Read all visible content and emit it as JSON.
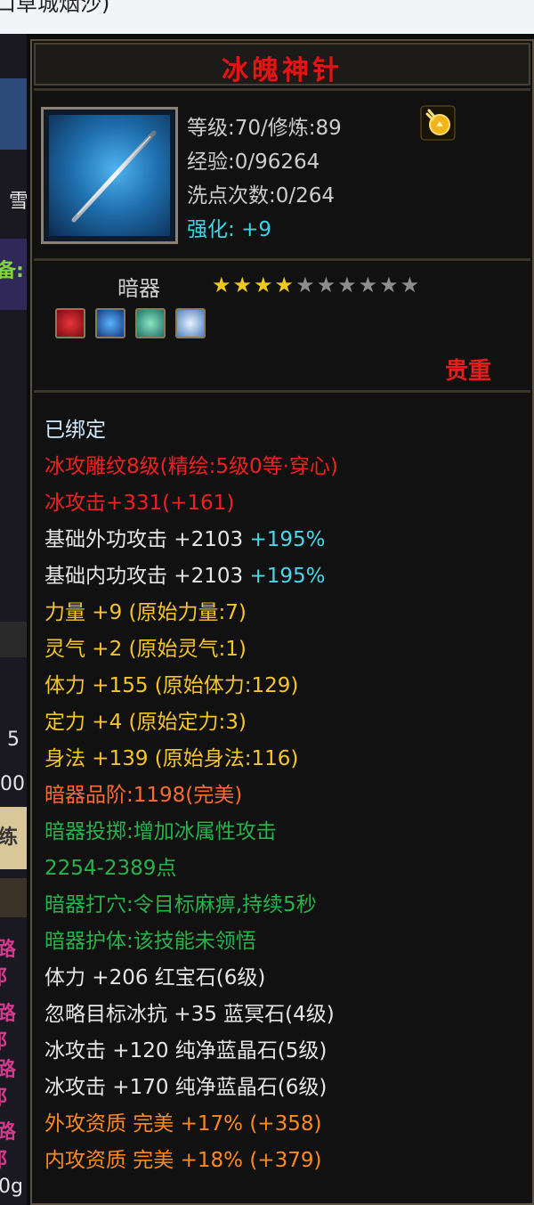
{
  "browser": {
    "title_fragment": "口草城烟沙)"
  },
  "side": {
    "label_snow": "雪",
    "label_prep": "备:",
    "num_5": "5",
    "num_00": "00",
    "label_lian": "练",
    "label_lu": [
      "路阝",
      "路阝",
      "路阝",
      "路阝",
      "路阝"
    ],
    "label_0": "0g"
  },
  "item": {
    "name": "冰魄神针",
    "level_line": "等级:70/修炼:89",
    "exp_line": "经验:0/96264",
    "wash_line": "洗点次数:0/264",
    "enhance_label": "强化:",
    "enhance_value": "+9",
    "type": "暗器",
    "stars_total": 10,
    "stars_filled": 4,
    "rarity": "贵重",
    "colors": {
      "title": "#e01515",
      "rarity": "#e61d1d",
      "enhance": "#37d7e8"
    },
    "gems": [
      "ruby-icon",
      "sapphire-icon",
      "emerald-icon",
      "diamond-icon"
    ]
  },
  "desc": {
    "bound": "已绑定",
    "carve": "冰攻雕纹8级(精绘:5级0等·穿心)",
    "ice_attack": "冰攻击+331(+161)",
    "ext_attack_label": "基础外功攻击 +2103",
    "ext_attack_pct": "+195%",
    "int_attack_label": "基础内功攻击 +2103",
    "int_attack_pct": "+195%",
    "strength": "力量 +9 (原始力量:7)",
    "spirit": "灵气 +2 (原始灵气:1)",
    "stamina": "体力 +155 (原始体力:129)",
    "focus": "定力 +4 (原始定力:3)",
    "agility": "身法 +139 (原始身法:116)",
    "grade_label": "暗器品阶:",
    "grade_value": "1198",
    "grade_quality": "(完美)",
    "throw": "暗器投掷:增加冰属性攻击",
    "throw_range": "2254-2389点",
    "acupoint": "暗器打穴:令目标麻痹,持续5秒",
    "guard": "暗器护体:该技能未领悟",
    "gem1_stat": "体力 +206",
    "gem1_name": "红宝石(6级)",
    "gem2_stat": "忽略目标冰抗 +35",
    "gem2_name": "蓝冥石(4级)",
    "gem3_stat": "冰攻击 +120",
    "gem3_name": "纯净蓝晶石(5级)",
    "gem4_stat": "冰攻击 +170",
    "gem4_name": "纯净蓝晶石(6级)",
    "apt1": "外攻资质  完美 +17% (+358)",
    "apt2": "内攻资质  完美 +18% (+379)"
  }
}
